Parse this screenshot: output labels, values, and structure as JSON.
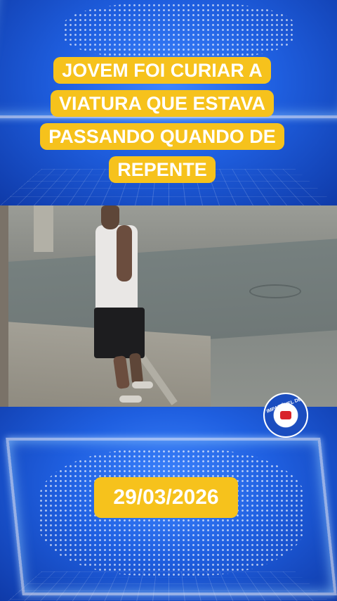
{
  "headline": "JOVEM FOI CURIAR A VIATURA QUE ESTAVA PASSANDO QUANDO DE REPENTE",
  "date": "29/03/2026",
  "watermark": {
    "text": "IMPARÁVEL DEC",
    "icon": "police-badge-icon"
  },
  "colors": {
    "badge": "#f6c21c",
    "background": "#1f5fe0"
  }
}
